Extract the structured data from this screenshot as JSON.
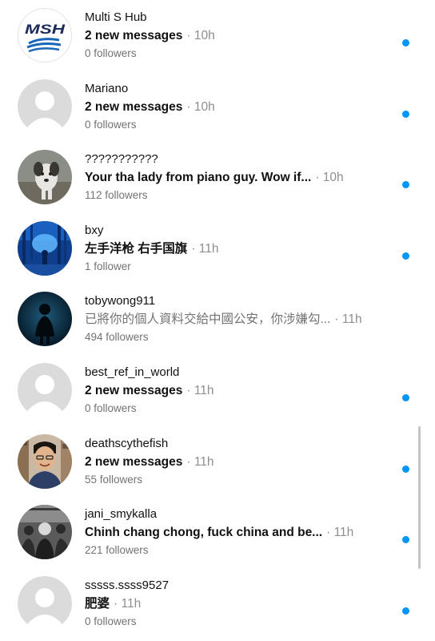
{
  "colors": {
    "unread_dot": "#0095f6",
    "secondary_text": "#737373",
    "placeholder_avatar": "#dbdbdb"
  },
  "threads": [
    {
      "name": "Multi S Hub",
      "message": "2 new messages",
      "time": "· 10h",
      "followers": "0 followers",
      "unread": true,
      "avatar": "multi-solutions-logo",
      "avatar_logo_text": "MSH MULTI SOLUTIONS"
    },
    {
      "name": "Mariano",
      "message": "2 new messages",
      "time": "· 10h",
      "followers": "0 followers",
      "unread": true,
      "avatar": "default-profile-icon"
    },
    {
      "name": "???????????",
      "message": "Your tha lady from piano guy. Wow if...",
      "time": "· 10h",
      "followers": "112 followers",
      "unread": true,
      "avatar": "dog-photo"
    },
    {
      "name": "bxy",
      "message": "左手洋枪 右手国旗",
      "time": "· 11h",
      "followers": "1 follower",
      "unread": true,
      "avatar": "blue-forest-photo"
    },
    {
      "name": "tobywong911",
      "message": "已將你的個人資料交給中國公安，你涉嫌勾...",
      "time": "· 11h",
      "followers": "494 followers",
      "unread": false,
      "avatar": "dark-silhouette-photo"
    },
    {
      "name": "best_ref_in_world",
      "message": "2 new messages",
      "time": "· 11h",
      "followers": "0 followers",
      "unread": true,
      "avatar": "default-profile-icon"
    },
    {
      "name": "deathscythefish",
      "message": "2 new messages",
      "time": "· 11h",
      "followers": "55 followers",
      "unread": true,
      "avatar": "man-portrait-photo"
    },
    {
      "name": "jani_smykalla",
      "message": "Chinh chang chong, fuck china and be...",
      "time": "· 11h",
      "followers": "221 followers",
      "unread": true,
      "avatar": "bw-crowd-photo"
    },
    {
      "name": "sssss.ssss9527",
      "message": "肥婆",
      "time": "· 11h",
      "followers": "0 followers",
      "unread": true,
      "avatar": "default-profile-icon"
    }
  ]
}
